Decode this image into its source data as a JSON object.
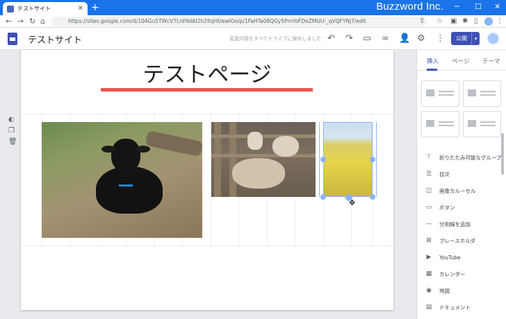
{
  "browser": {
    "tab_title": "テストサイト",
    "url": "https://sites.google.com/d/104Gu5TWcV7LrdYeIAI2h2ltqHUewlOo/p/1FaHTa08QGy5PmYoFDoZMUU-_qVQFYNj7/edit",
    "brand": "Buzzword Inc."
  },
  "app": {
    "site_name": "テストサイト",
    "save_status": "変更内容をすべてドライブに保存しました",
    "publish_label": "公開"
  },
  "page": {
    "title": "テストページ"
  },
  "sidebar": {
    "tabs": [
      {
        "label": "挿入"
      },
      {
        "label": "ページ"
      },
      {
        "label": "テーマ"
      }
    ],
    "insert_items": [
      {
        "label": "折りたたみ可能なグループ",
        "icon": "collapsible-icon"
      },
      {
        "label": "目次",
        "icon": "toc-icon"
      },
      {
        "label": "画像カルーセル",
        "icon": "carousel-icon"
      },
      {
        "label": "ボタン",
        "icon": "button-icon"
      },
      {
        "label": "分割線を追加",
        "icon": "divider-icon"
      },
      {
        "label": "プレースホルダ",
        "icon": "placeholder-icon"
      },
      {
        "label": "YouTube",
        "icon": "youtube-icon"
      },
      {
        "label": "カレンダー",
        "icon": "calendar-icon"
      },
      {
        "label": "地図",
        "icon": "map-pin-icon"
      },
      {
        "label": "ドキュメント",
        "icon": "document-icon"
      }
    ]
  },
  "colors": {
    "browser_bar": "#1a73e8",
    "publish": "#3f51b5",
    "title_underline": "#ef5350",
    "selection": "#8ab4f8"
  }
}
